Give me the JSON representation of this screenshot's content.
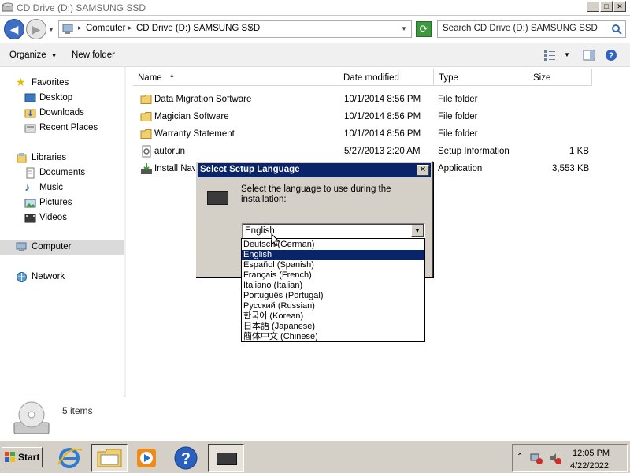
{
  "window": {
    "title": "CD Drive (D:) SAMSUNG SSD",
    "controls": [
      "_",
      "□",
      "✕"
    ]
  },
  "address": {
    "crumbs": [
      "Computer",
      "CD Drive (D:) SAMSUNG SSD"
    ],
    "search_placeholder": "Search CD Drive (D:) SAMSUNG SSD"
  },
  "commands": {
    "organize": "Organize",
    "new_folder": "New folder"
  },
  "nav": {
    "favorites": "Favorites",
    "desktop": "Desktop",
    "downloads": "Downloads",
    "recent": "Recent Places",
    "libraries": "Libraries",
    "documents": "Documents",
    "music": "Music",
    "pictures": "Pictures",
    "videos": "Videos",
    "computer": "Computer",
    "network": "Network"
  },
  "columns": {
    "name": "Name",
    "date": "Date modified",
    "type": "Type",
    "size": "Size"
  },
  "files": [
    {
      "name": "Data Migration Software",
      "date": "10/1/2014 8:56 PM",
      "type": "File folder",
      "size": "",
      "icon": "folder-icon"
    },
    {
      "name": "Magician Software",
      "date": "10/1/2014 8:56 PM",
      "type": "File folder",
      "size": "",
      "icon": "folder-icon"
    },
    {
      "name": "Warranty Statement",
      "date": "10/1/2014 8:56 PM",
      "type": "File folder",
      "size": "",
      "icon": "folder-icon"
    },
    {
      "name": "autorun",
      "date": "5/27/2013 2:20 AM",
      "type": "Setup Information",
      "size": "1 KB",
      "icon": "setup-info-icon"
    },
    {
      "name": "Install Nav",
      "date": "",
      "type": "Application",
      "size": "3,553 KB",
      "icon": "installer-icon"
    }
  ],
  "details": {
    "count": "5 items"
  },
  "dialog": {
    "title": "Select Setup Language",
    "prompt": "Select the language to use during the installation:",
    "selected": "English",
    "options": [
      "Deutsch (German)",
      "English",
      "Español (Spanish)",
      "Français (French)",
      "Italiano (Italian)",
      "Português (Portugal)",
      "Русский (Russian)",
      "한국어 (Korean)",
      "日本語 (Japanese)",
      "簡体中文 (Chinese)"
    ],
    "highlighted_index": 1
  },
  "taskbar": {
    "start": "Start",
    "time": "12:05 PM",
    "date": "4/22/2022"
  }
}
